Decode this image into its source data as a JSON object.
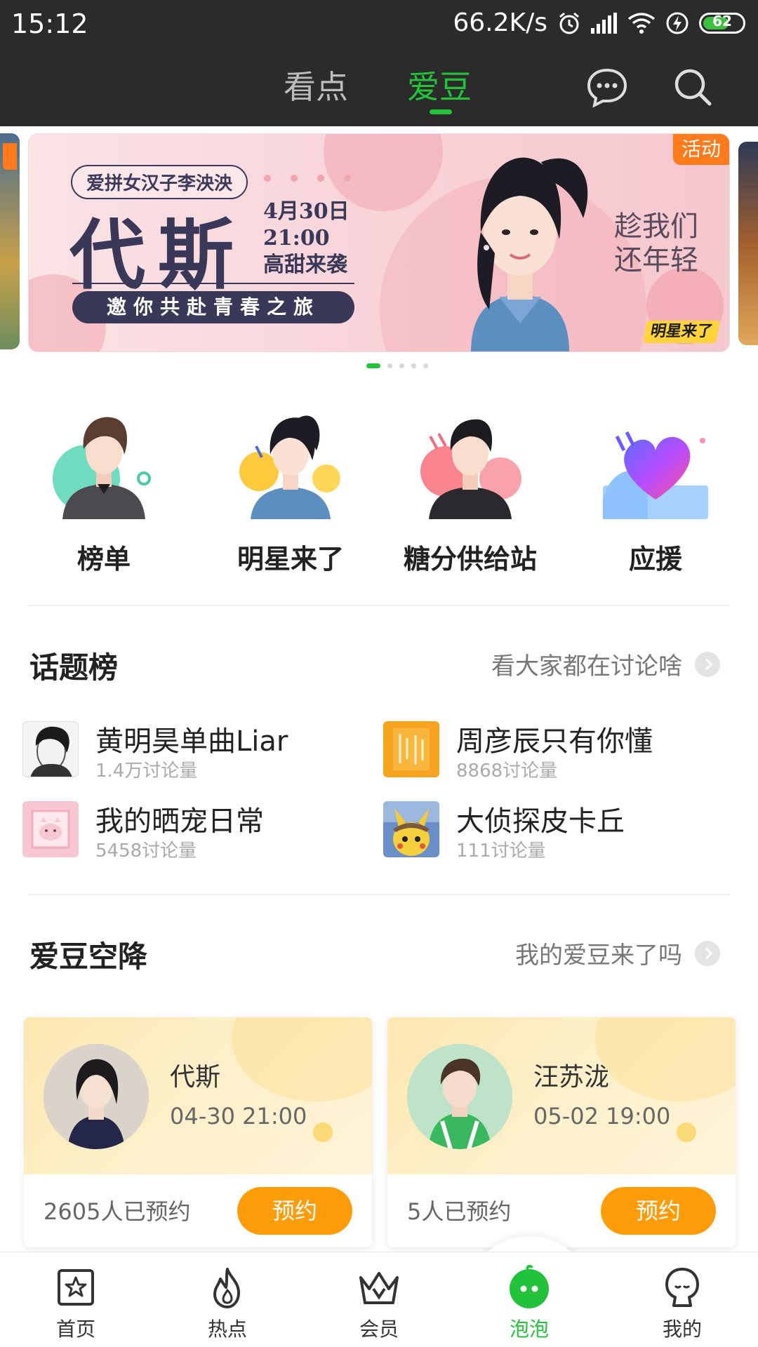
{
  "status_bar": {
    "time": "15:12",
    "network_speed": "66.2K/s",
    "battery": "62",
    "battery_fraction": 0.62
  },
  "top_nav": {
    "tabs": [
      "看点",
      "爱豆"
    ],
    "active_tab": "爱豆",
    "icons": [
      "chat-icon",
      "search-icon"
    ],
    "accent_color": "#22c33a"
  },
  "banner": {
    "badge": "活动",
    "pill_text": "爱拼女汉子李泱泱",
    "headline": "代斯",
    "date": "4月30日",
    "time": "21:00",
    "subline": "高甜来袭",
    "invite": "邀你共赴青春之旅",
    "slogan_1": "趁我们",
    "slogan_2": "还年轻",
    "logo_text": "明星来了",
    "page_count": 5,
    "active_page": 1
  },
  "quick_entries": [
    {
      "label": "榜单",
      "icon": "ranking-icon"
    },
    {
      "label": "明星来了",
      "icon": "star-icon"
    },
    {
      "label": "糖分供给站",
      "icon": "candy-station-icon"
    },
    {
      "label": "应援",
      "icon": "heart-support-icon"
    }
  ],
  "topics": {
    "title": "话题榜",
    "more": "看大家都在讨论啥",
    "items": [
      {
        "name": "黄明昊单曲Liar",
        "count": "1.4万讨论量"
      },
      {
        "name": "周彦辰只有你懂",
        "count": "8868讨论量"
      },
      {
        "name": "我的晒宠日常",
        "count": "5458讨论量"
      },
      {
        "name": "大侦探皮卡丘",
        "count": "111讨论量"
      }
    ]
  },
  "idol_drop": {
    "title": "爱豆空降",
    "more": "我的爱豆来了吗",
    "cards": [
      {
        "name": "代斯",
        "time": "04-30 21:00",
        "booked": "2605人已预约",
        "button": "预约"
      },
      {
        "name": "汪苏泷",
        "time": "05-02 19:00",
        "booked": "5人已预约",
        "button": "预约"
      }
    ]
  },
  "tabbar": {
    "items": [
      {
        "label": "首页",
        "icon": "home-icon"
      },
      {
        "label": "热点",
        "icon": "flame-icon"
      },
      {
        "label": "会员",
        "icon": "crown-icon"
      },
      {
        "label": "泡泡",
        "icon": "bubble-icon"
      },
      {
        "label": "我的",
        "icon": "profile-icon"
      }
    ],
    "active": "泡泡",
    "button_color": "#ff9c0a"
  }
}
